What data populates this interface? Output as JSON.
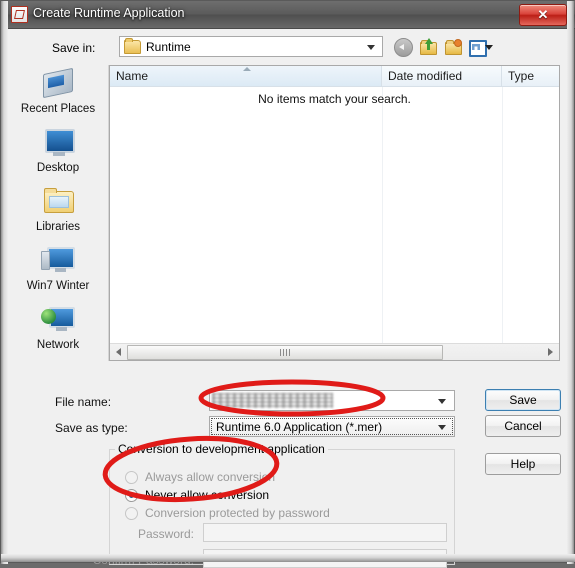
{
  "window": {
    "title": "Create Runtime Application",
    "app_icon": "application-icon",
    "close_label": "✕"
  },
  "toolbar": {
    "save_in_label": "Save in:",
    "save_in_value": "Runtime",
    "buttons": [
      {
        "name": "back-button",
        "icon": "back-arrow-icon"
      },
      {
        "name": "up-one-level-button",
        "icon": "up-folder-icon"
      },
      {
        "name": "new-folder-button",
        "icon": "new-folder-icon"
      },
      {
        "name": "views-button",
        "icon": "views-grid-icon"
      }
    ]
  },
  "places_bar": {
    "items": [
      {
        "label": "Recent Places",
        "icon": "recent-places-icon"
      },
      {
        "label": "Desktop",
        "icon": "desktop-icon"
      },
      {
        "label": "Libraries",
        "icon": "libraries-icon"
      },
      {
        "label": "Win7 Winter",
        "icon": "computer-icon"
      },
      {
        "label": "Network",
        "icon": "network-icon"
      }
    ]
  },
  "file_list": {
    "columns": [
      {
        "label": "Name",
        "sorted": "ascending"
      },
      {
        "label": "Date modified"
      },
      {
        "label": "Type"
      }
    ],
    "rows": [],
    "empty_message": "No items match your search."
  },
  "form": {
    "file_name_label": "File name:",
    "file_name_value": "",
    "file_name_redacted": true,
    "save_as_type_label": "Save as type:",
    "save_as_type_value": "Runtime 6.0 Application (*.mer)"
  },
  "buttons": {
    "save": "Save",
    "cancel": "Cancel",
    "help": "Help"
  },
  "conversion_group": {
    "title": "Conversion to development application",
    "options": [
      {
        "label": "Always allow conversion",
        "selected": false,
        "disabled": true
      },
      {
        "label": "Never allow conversion",
        "selected": true,
        "disabled": false
      },
      {
        "label": "Conversion protected by password",
        "selected": false,
        "disabled": true
      }
    ],
    "password_label": "Password:",
    "password_value": "",
    "confirm_password_label": "Confirm Password:",
    "confirm_password_value": ""
  },
  "annotations": {
    "color": "#e01b18",
    "shapes": [
      {
        "name": "save-as-type-highlight",
        "target": "save_as_type"
      },
      {
        "name": "conversion-options-highlight",
        "target": "conversion_radios"
      }
    ]
  }
}
